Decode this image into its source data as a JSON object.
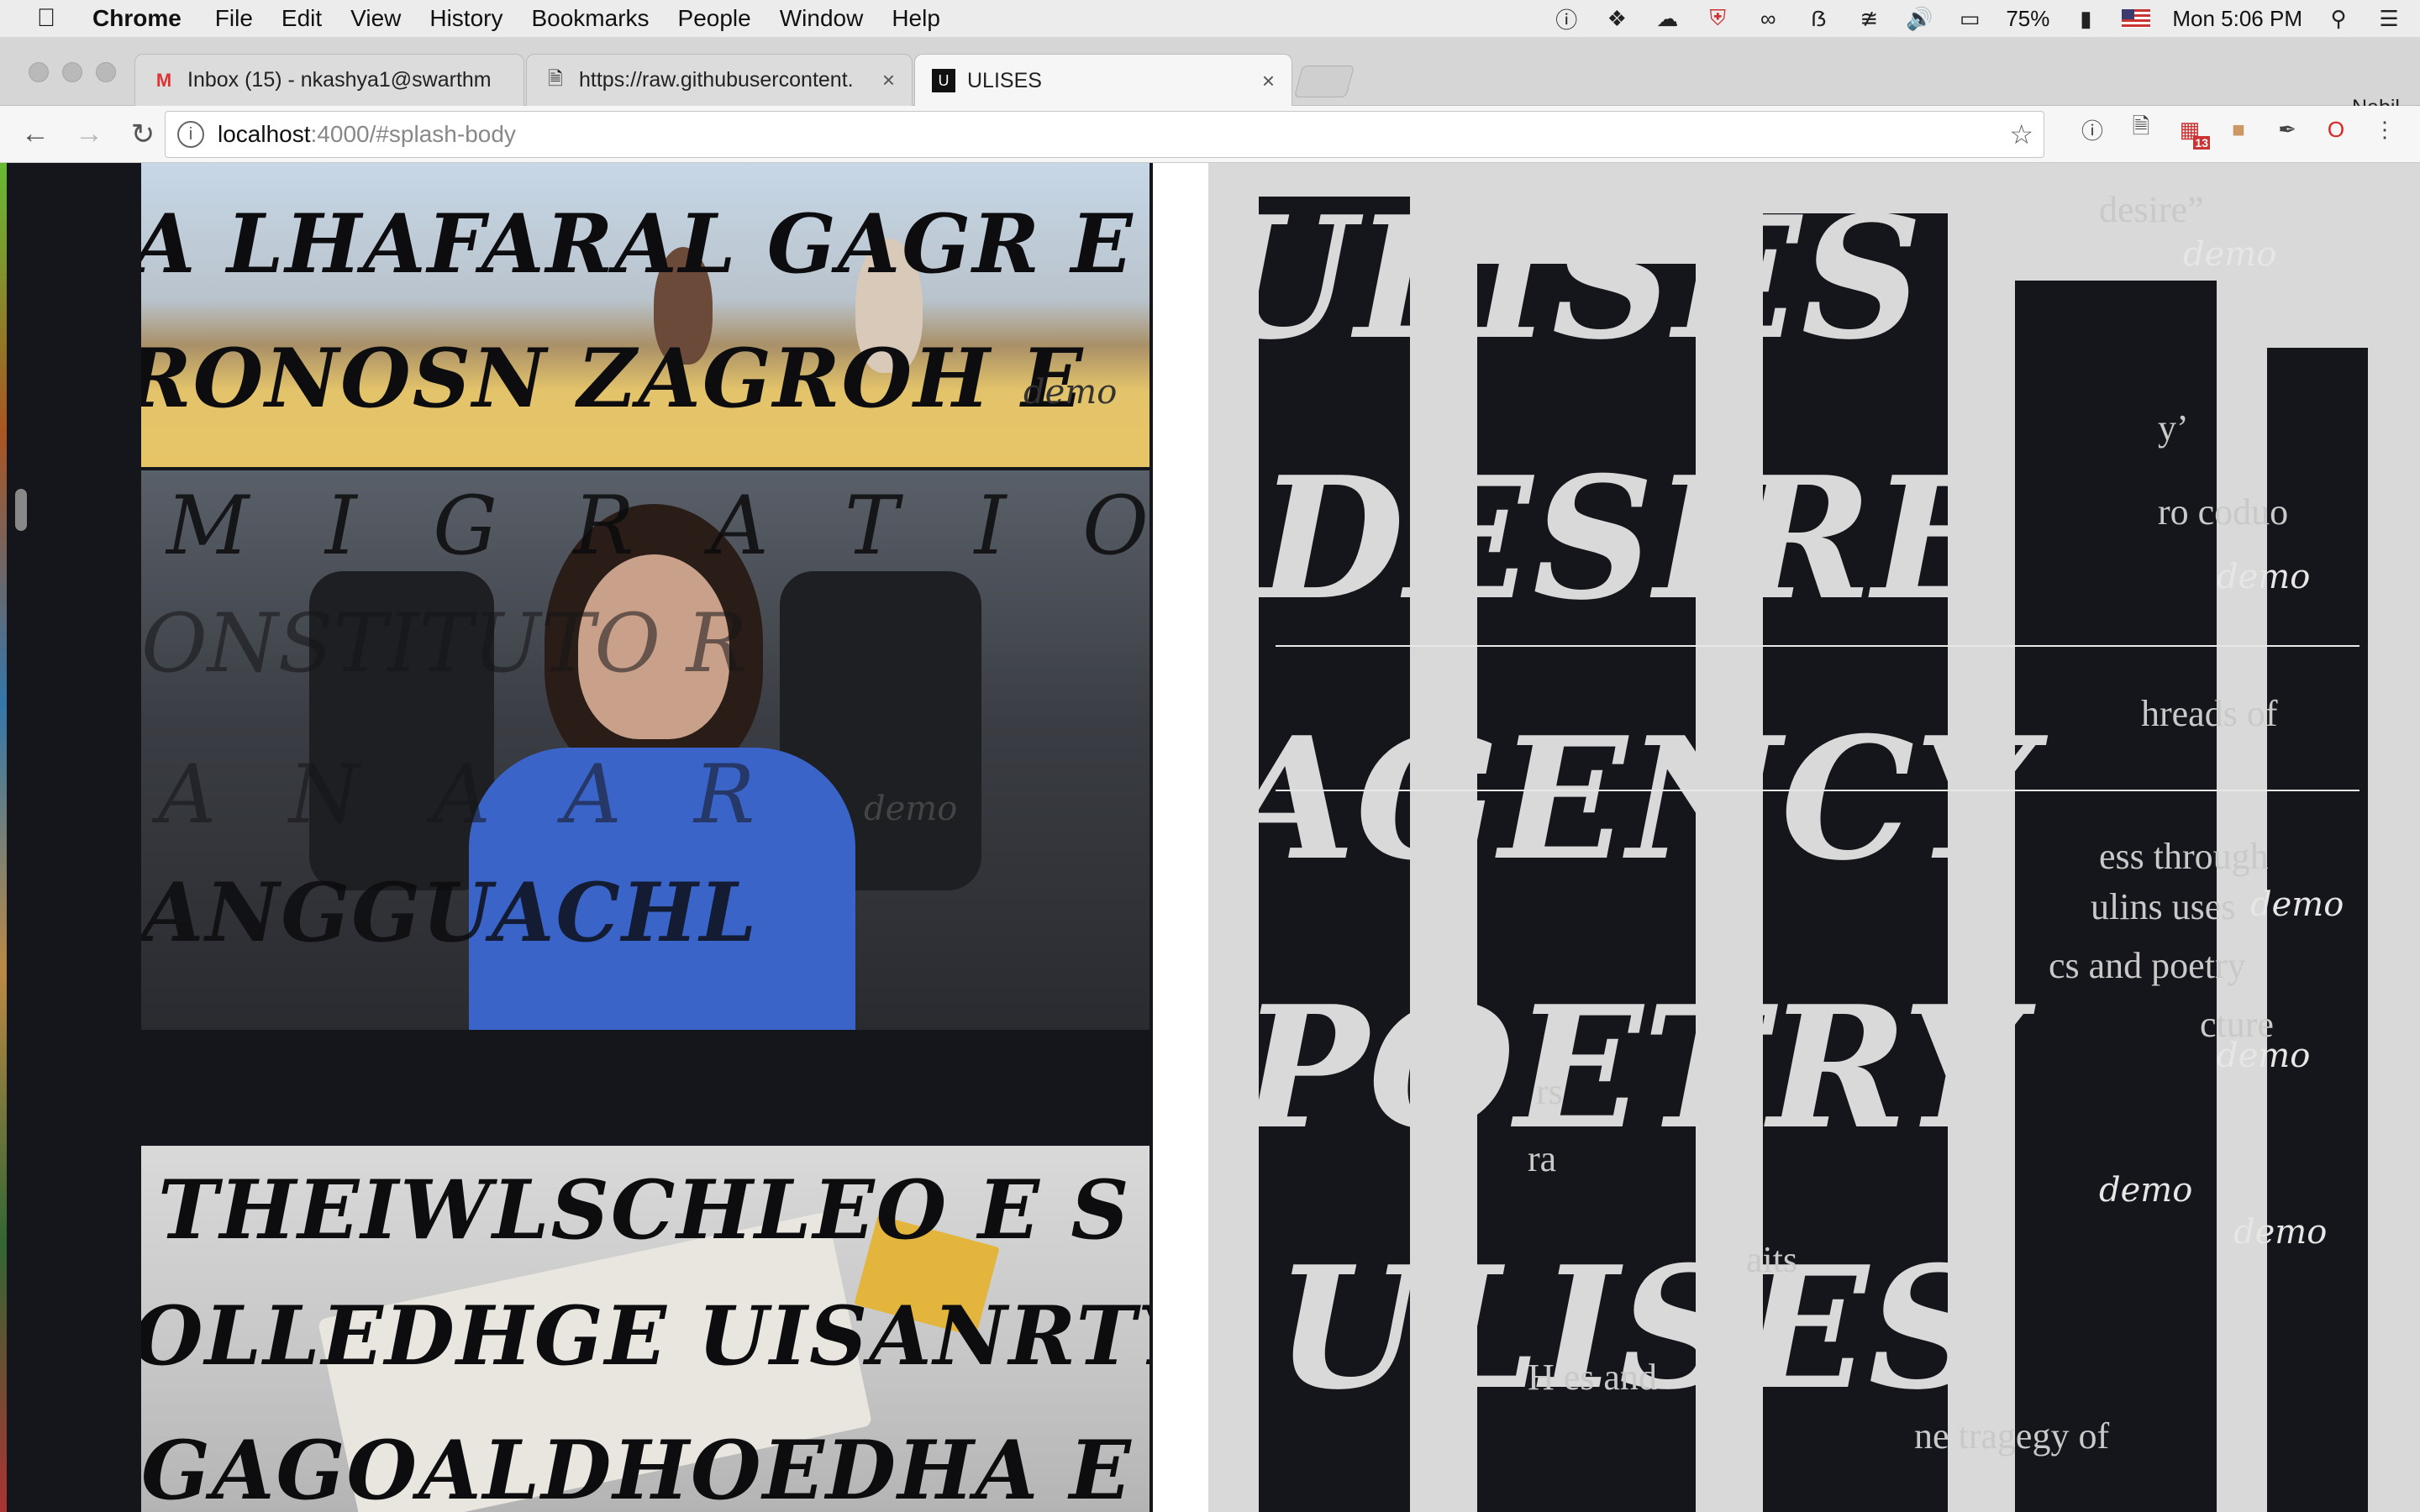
{
  "menubar": {
    "app": "Chrome",
    "items": [
      "File",
      "Edit",
      "View",
      "History",
      "Bookmarks",
      "People",
      "Window",
      "Help"
    ],
    "battery": "75%",
    "clock": "Mon 5:06 PM"
  },
  "tabs": [
    {
      "title": "Inbox (15) - nkashya1@swarthm",
      "favicon": "gmail-icon"
    },
    {
      "title": "https://raw.githubusercontent.",
      "favicon": "document-icon"
    },
    {
      "title": "ULISES",
      "favicon": "ulises-icon"
    }
  ],
  "profile_name": "Nabil",
  "address": {
    "host": "localhost",
    "path": ":4000/#splash-body"
  },
  "extensions": {
    "calendar_badge": "13"
  },
  "page": {
    "left_panels": [
      {
        "lines": [
          "A LHAFARAL GAGR E",
          "RONOSN ZAGROH E"
        ]
      },
      {
        "lines": [
          "M I G R A T I O N S",
          "ONSTITUTO R",
          "A N A  A R",
          "ANGGUACHL"
        ]
      },
      {
        "lines": [
          "THEIWLSCHLEO E S",
          "OLLEDHGE UISANRTY",
          "GAGOALDHOEDHA E"
        ]
      }
    ],
    "right_words": [
      "ULISES",
      "DESIRE",
      "AGENCY",
      "POETRY"
    ],
    "right_text": [
      "desire”",
      "y’",
      "ro coduo",
      "hreads of",
      "ess through",
      "ulins uses",
      "cs and poetry",
      "cture",
      "rs",
      "ra",
      "aits",
      "H es and",
      "ne tragegy of"
    ],
    "demo_label": "demo"
  }
}
